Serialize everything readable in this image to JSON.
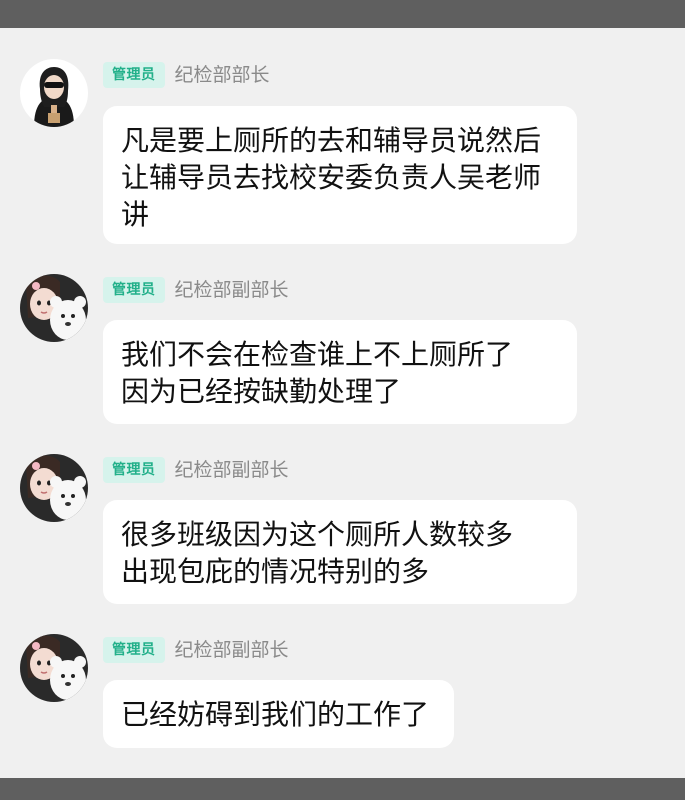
{
  "messages": [
    {
      "role_badge": "管理员",
      "sender": "纪检部部长",
      "avatar": "avatar-girl-sunglasses",
      "text": "凡是要上厕所的去和辅导员说然后\n让辅导员去找校安委负责人吴老师\n讲"
    },
    {
      "role_badge": "管理员",
      "sender": "纪检部副部长",
      "avatar": "avatar-girl-plush",
      "text": "我们不会在检查谁上不上厕所了\n因为已经按缺勤处理了"
    },
    {
      "role_badge": "管理员",
      "sender": "纪检部副部长",
      "avatar": "avatar-girl-plush",
      "text": "很多班级因为这个厕所人数较多\n出现包庇的情况特别的多"
    },
    {
      "role_badge": "管理员",
      "sender": "纪检部副部长",
      "avatar": "avatar-girl-plush",
      "text": "已经妨碍到我们的工作了"
    }
  ],
  "colors": {
    "background": "#f0f0f0",
    "bars": "#5f5f5f",
    "badge_bg": "#d6f3ec",
    "badge_text": "#22b08a",
    "sender_text": "#8a8a8a",
    "bubble_bg": "#ffffff"
  }
}
